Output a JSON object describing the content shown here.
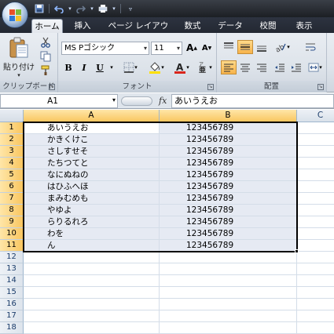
{
  "ribbon_tabs": [
    "ホーム",
    "挿入",
    "ページ レイアウト",
    "数式",
    "データ",
    "校閲",
    "表示"
  ],
  "active_tab": "ホーム",
  "clipboard": {
    "paste_label": "貼り付け",
    "group_label": "クリップボード"
  },
  "font": {
    "name": "MS Pゴシック",
    "size": "11",
    "group_label": "フォント",
    "bold": "B",
    "italic": "I",
    "underline": "U",
    "grow": "A",
    "shrink": "A"
  },
  "alignment": {
    "group_label": "配置"
  },
  "formula_bar": {
    "name_box": "A1",
    "fx": "fx",
    "content": "あいうえお"
  },
  "columns": [
    "A",
    "B",
    "C"
  ],
  "rows": [
    {
      "num": "1",
      "a": "あいうえお",
      "b": "123456789"
    },
    {
      "num": "2",
      "a": "かきくけこ",
      "b": "123456789"
    },
    {
      "num": "3",
      "a": "さしすせそ",
      "b": "123456789"
    },
    {
      "num": "4",
      "a": "たちつてと",
      "b": "123456789"
    },
    {
      "num": "5",
      "a": "なにぬねの",
      "b": "123456789"
    },
    {
      "num": "6",
      "a": "はひふへほ",
      "b": "123456789"
    },
    {
      "num": "7",
      "a": "まみむめも",
      "b": "123456789"
    },
    {
      "num": "8",
      "a": "やゆよ",
      "b": "123456789"
    },
    {
      "num": "9",
      "a": "らりるれろ",
      "b": "123456789"
    },
    {
      "num": "10",
      "a": "わを",
      "b": "123456789"
    },
    {
      "num": "11",
      "a": "ん",
      "b": "123456789"
    },
    {
      "num": "12",
      "a": "",
      "b": ""
    },
    {
      "num": "13",
      "a": "",
      "b": ""
    },
    {
      "num": "14",
      "a": "",
      "b": ""
    },
    {
      "num": "15",
      "a": "",
      "b": ""
    },
    {
      "num": "16",
      "a": "",
      "b": ""
    },
    {
      "num": "17",
      "a": "",
      "b": ""
    },
    {
      "num": "18",
      "a": "",
      "b": ""
    }
  ],
  "selected_rows_count": 11,
  "icons": {
    "save": "save-icon",
    "undo": "undo-icon",
    "redo": "redo-icon",
    "print": "print-icon",
    "cut": "scissors-icon",
    "copy": "copy-icon",
    "format_painter": "brush-icon",
    "fill_color": "paint-bucket-icon",
    "font_color": "font-color-icon",
    "borders": "borders-icon"
  },
  "colors": {
    "selection": "#e6eaf3",
    "header_selected": "#f9c660",
    "ribbon": "#dde3ea",
    "font_color_red": "#d9261c",
    "fill_yellow": "#ffe000"
  }
}
